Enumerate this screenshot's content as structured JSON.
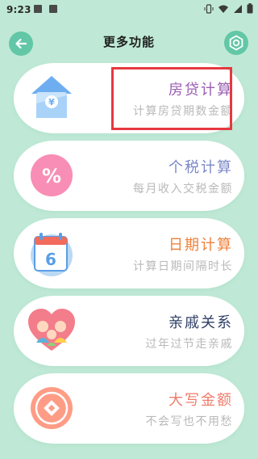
{
  "status": {
    "time": "9:23"
  },
  "header": {
    "title": "更多功能"
  },
  "items": [
    {
      "name": "房贷计算",
      "desc": "计算房贷期数金额",
      "color": "#9a5fb4",
      "icon": "house-icon"
    },
    {
      "name": "个税计算",
      "desc": "每月收入交税金额",
      "color": "#7b89c9",
      "icon": "percent-icon"
    },
    {
      "name": "日期计算",
      "desc": "计算日期间隔时长",
      "color": "#f0813a",
      "icon": "calendar-icon"
    },
    {
      "name": "亲戚关系",
      "desc": "过年过节走亲戚",
      "color": "#2f3f66",
      "icon": "family-heart-icon"
    },
    {
      "name": "大写金额",
      "desc": "不会写也不用愁",
      "color": "#f07b6b",
      "icon": "coin-icon"
    }
  ],
  "colors": {
    "background": "#bfe9d6",
    "accent": "#62c7a6",
    "highlight": "#e53940"
  }
}
